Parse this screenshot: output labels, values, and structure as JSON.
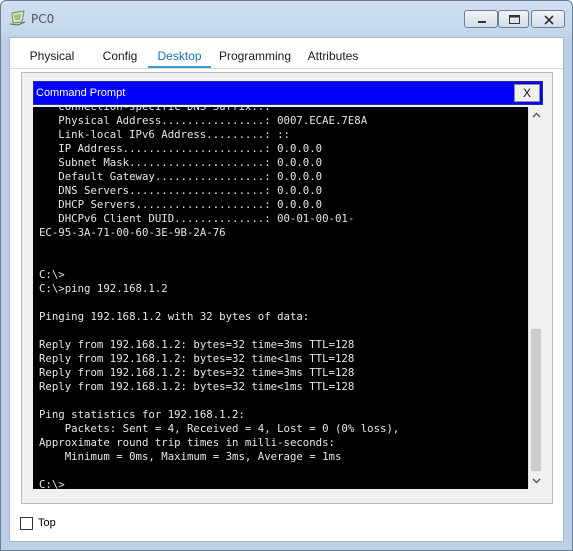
{
  "window": {
    "title": "PC0",
    "icon": "pc-icon",
    "controls": [
      "minimize-icon",
      "maximize-icon",
      "close-icon"
    ]
  },
  "tabs": [
    {
      "label": "Physical",
      "active": false
    },
    {
      "label": "Config",
      "active": false
    },
    {
      "label": "Desktop",
      "active": true
    },
    {
      "label": "Programming",
      "active": false
    },
    {
      "label": "Attributes",
      "active": false
    }
  ],
  "command_prompt": {
    "title": "Command Prompt",
    "close_label": "X",
    "lines": [
      "   Connection-specific DNS Suffix..:",
      "   Physical Address................: 0007.ECAE.7E8A",
      "   Link-local IPv6 Address.........: ::",
      "   IP Address......................: 0.0.0.0",
      "   Subnet Mask.....................: 0.0.0.0",
      "   Default Gateway.................: 0.0.0.0",
      "   DNS Servers.....................: 0.0.0.0",
      "   DHCP Servers....................: 0.0.0.0",
      "   DHCPv6 Client DUID..............: 00-01-00-01-",
      "EC-95-3A-71-00-60-3E-9B-2A-76",
      "",
      "",
      "C:\\>",
      "C:\\>ping 192.168.1.2",
      "",
      "Pinging 192.168.1.2 with 32 bytes of data:",
      "",
      "Reply from 192.168.1.2: bytes=32 time=3ms TTL=128",
      "Reply from 192.168.1.2: bytes=32 time<1ms TTL=128",
      "Reply from 192.168.1.2: bytes=32 time=3ms TTL=128",
      "Reply from 192.168.1.2: bytes=32 time<1ms TTL=128",
      "",
      "Ping statistics for 192.168.1.2:",
      "    Packets: Sent = 4, Received = 4, Lost = 0 (0% loss),",
      "Approximate round trip times in milli-seconds:",
      "    Minimum = 0ms, Maximum = 3ms, Average = 1ms",
      "",
      "C:\\>"
    ]
  },
  "footer": {
    "top_checkbox_label": "Top",
    "top_checked": false
  },
  "colors": {
    "terminal_bg": "#000000",
    "terminal_text": "#e6e6e6",
    "cmd_header": "#0000ff",
    "active_tab": "#3d98d6"
  }
}
